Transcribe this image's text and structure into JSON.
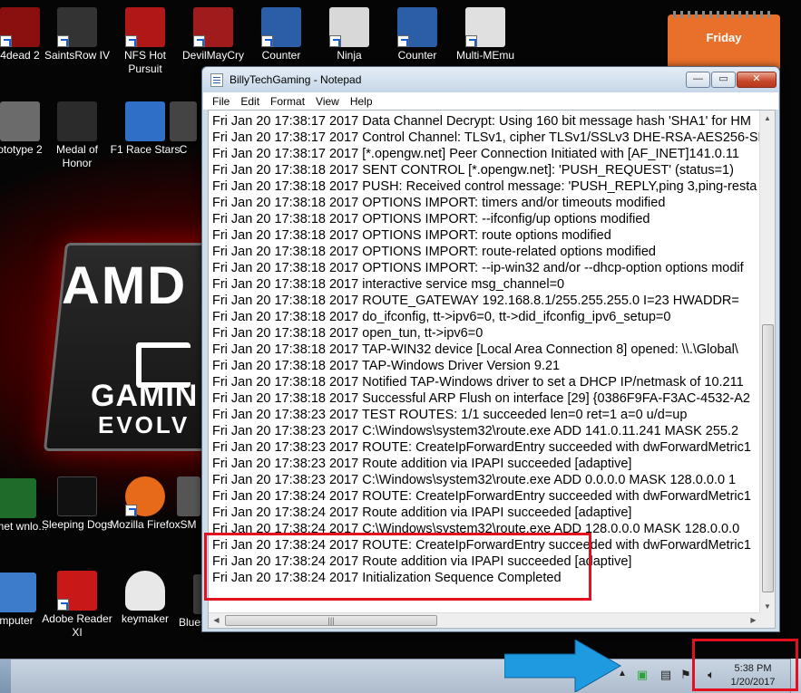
{
  "desktop": {
    "icons": [
      {
        "id": "left4dead",
        "label": "4dead 2",
        "color": "#8a1010"
      },
      {
        "id": "saintsrow",
        "label": "SaintsRow IV",
        "color": "#333333"
      },
      {
        "id": "nfs",
        "label": "NFS Hot Pursuit",
        "color": "#b01818"
      },
      {
        "id": "devilmaycry",
        "label": "DevilMayCry",
        "color": "#a01c1c"
      },
      {
        "id": "counter1",
        "label": "Counter",
        "color": "#2a5fa8"
      },
      {
        "id": "ninja",
        "label": "Ninja",
        "color": "#d8d8d8"
      },
      {
        "id": "counter2",
        "label": "Counter",
        "color": "#2a5fa8"
      },
      {
        "id": "multimemu",
        "label": "Multi-MEmu",
        "color": "#e0e0e0"
      },
      {
        "id": "prototype",
        "label": "ototype 2",
        "color": "#6b6b6b"
      },
      {
        "id": "medalofhonor",
        "label": "Medal of Honor",
        "color": "#2b2b2b"
      },
      {
        "id": "f1racestars",
        "label": "F1 Race Stars",
        "color": "#2f6fc8"
      },
      {
        "id": "c_partial",
        "label": "C",
        "color": "#444444"
      },
      {
        "id": "internet",
        "label": "ternet wnlo...",
        "color": "#1f6b2a"
      },
      {
        "id": "sleepingdogs",
        "label": "Sleeping Dogs",
        "color": "#111111"
      },
      {
        "id": "firefox",
        "label": "Mozilla Firefox",
        "color": "#e66a1a"
      },
      {
        "id": "sm_partial",
        "label": "SM",
        "color": "#555555"
      },
      {
        "id": "computer",
        "label": "mputer",
        "color": "#3c7cc8"
      },
      {
        "id": "adobe",
        "label": "Adobe Reader XI",
        "color": "#c81818"
      },
      {
        "id": "keymaker",
        "label": "keymaker",
        "color": "#e8e8e8"
      },
      {
        "id": "bluestacks",
        "label": "Bluestacks",
        "color": "#3a3a3a"
      }
    ],
    "calendar": {
      "day": "Friday"
    },
    "wallpaper": {
      "brand": "AMD",
      "line1": "GAMIN",
      "line2": "EVOLV"
    }
  },
  "window": {
    "title": "BillyTechGaming - Notepad",
    "buttons": {
      "minimize": "—",
      "maximize": "▭",
      "close": "✕"
    },
    "menu": [
      "File",
      "Edit",
      "Format",
      "View",
      "Help"
    ],
    "lines": [
      "Fri Jan 20 17:38:17 2017 Data Channel Decrypt: Using 160 bit message hash 'SHA1' for HM",
      "Fri Jan 20 17:38:17 2017 Control Channel: TLSv1, cipher TLSv1/SSLv3 DHE-RSA-AES256-SH",
      "Fri Jan 20 17:38:17 2017 [*.opengw.net] Peer Connection Initiated with [AF_INET]141.0.11",
      "Fri Jan 20 17:38:18 2017 SENT CONTROL [*.opengw.net]: 'PUSH_REQUEST' (status=1)",
      "Fri Jan 20 17:38:18 2017 PUSH: Received control message: 'PUSH_REPLY,ping 3,ping-resta",
      "Fri Jan 20 17:38:18 2017 OPTIONS IMPORT: timers and/or timeouts modified",
      "Fri Jan 20 17:38:18 2017 OPTIONS IMPORT: --ifconfig/up options modified",
      "Fri Jan 20 17:38:18 2017 OPTIONS IMPORT: route options modified",
      "Fri Jan 20 17:38:18 2017 OPTIONS IMPORT: route-related options modified",
      "Fri Jan 20 17:38:18 2017 OPTIONS IMPORT: --ip-win32 and/or --dhcp-option options modif",
      "Fri Jan 20 17:38:18 2017 interactive service msg_channel=0",
      "Fri Jan 20 17:38:18 2017 ROUTE_GATEWAY 192.168.8.1/255.255.255.0 I=23 HWADDR=",
      "Fri Jan 20 17:38:18 2017 do_ifconfig, tt->ipv6=0, tt->did_ifconfig_ipv6_setup=0",
      "Fri Jan 20 17:38:18 2017 open_tun, tt->ipv6=0",
      "Fri Jan 20 17:38:18 2017 TAP-WIN32 device [Local Area Connection 8] opened: \\\\.\\Global\\",
      "Fri Jan 20 17:38:18 2017 TAP-Windows Driver Version 9.21",
      "Fri Jan 20 17:38:18 2017 Notified TAP-Windows driver to set a DHCP IP/netmask of 10.211",
      "Fri Jan 20 17:38:18 2017 Successful ARP Flush on interface [29] {0386F9FA-F3AC-4532-A2",
      "Fri Jan 20 17:38:23 2017 TEST ROUTES: 1/1 succeeded len=0 ret=1 a=0 u/d=up",
      "Fri Jan 20 17:38:23 2017 C:\\Windows\\system32\\route.exe ADD 141.0.11.241 MASK 255.2",
      "Fri Jan 20 17:38:23 2017 ROUTE: CreateIpForwardEntry succeeded with dwForwardMetric1",
      "Fri Jan 20 17:38:23 2017 Route addition via IPAPI succeeded [adaptive]",
      "Fri Jan 20 17:38:23 2017 C:\\Windows\\system32\\route.exe ADD 0.0.0.0 MASK 128.0.0.0 1",
      "Fri Jan 20 17:38:24 2017 ROUTE: CreateIpForwardEntry succeeded with dwForwardMetric1",
      "Fri Jan 20 17:38:24 2017 Route addition via IPAPI succeeded [adaptive]",
      "Fri Jan 20 17:38:24 2017 C:\\Windows\\system32\\route.exe ADD 128.0.0.0 MASK 128.0.0.0",
      "Fri Jan 20 17:38:24 2017 ROUTE: CreateIpForwardEntry succeeded with dwForwardMetric1",
      "Fri Jan 20 17:38:24 2017 Route addition via IPAPI succeeded [adaptive]",
      "Fri Jan 20 17:38:24 2017 Initialization Sequence Completed"
    ]
  },
  "taskbar": {
    "tray_icons": [
      "network-icon",
      "display-icon",
      "action-center-flag-icon",
      "volume-icon"
    ],
    "clock": {
      "time": "5:38 PM",
      "date": "1/20/2017"
    }
  },
  "annotations": {
    "highlight_color": "#e3101f",
    "arrow_color": "#1e9be0"
  }
}
